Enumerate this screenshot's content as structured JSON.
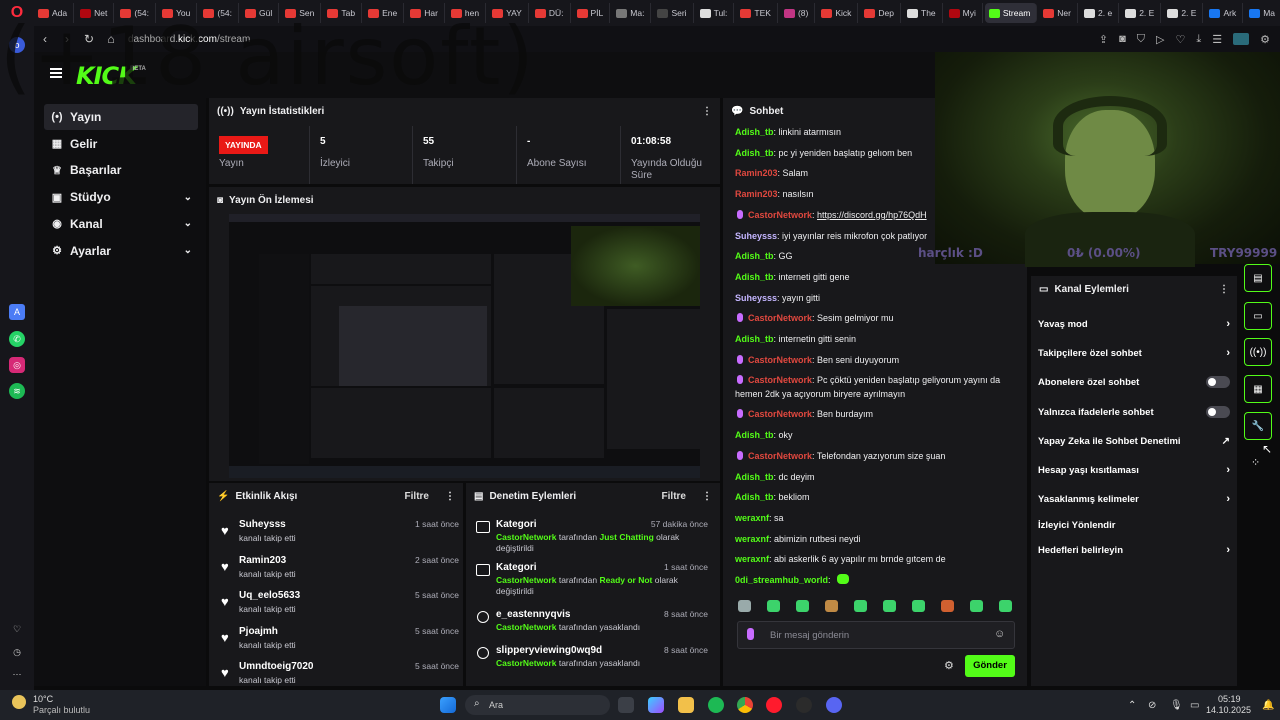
{
  "browser": {
    "tabs": [
      {
        "label": "Ada",
        "color": "#e53935"
      },
      {
        "label": "Net",
        "color": "#b00710"
      },
      {
        "label": "(54:",
        "color": "#e53935"
      },
      {
        "label": "You",
        "color": "#e53935"
      },
      {
        "label": "(54:",
        "color": "#e53935"
      },
      {
        "label": "Gül",
        "color": "#e53935"
      },
      {
        "label": "Sen",
        "color": "#e53935"
      },
      {
        "label": "Tab",
        "color": "#e53935"
      },
      {
        "label": "Ene",
        "color": "#e53935"
      },
      {
        "label": "Har",
        "color": "#e53935"
      },
      {
        "label": "hen",
        "color": "#e53935"
      },
      {
        "label": "YAY",
        "color": "#e53935"
      },
      {
        "label": "DÜ:",
        "color": "#e53935"
      },
      {
        "label": "PİL",
        "color": "#e53935"
      },
      {
        "label": "Ma:",
        "color": "#777"
      },
      {
        "label": "Seri",
        "color": "#444"
      },
      {
        "label": "Tul:",
        "color": "#ddd"
      },
      {
        "label": "TEK",
        "color": "#e53935"
      },
      {
        "label": "(8) ",
        "color": "#c13584"
      },
      {
        "label": "Kick",
        "color": "#e53935"
      },
      {
        "label": "Dep",
        "color": "#e53935"
      },
      {
        "label": "The",
        "color": "#ddd"
      },
      {
        "label": "Myi",
        "color": "#b00710"
      },
      {
        "label": "Stream",
        "color": "#53fc18",
        "active": true
      },
      {
        "label": "Ner",
        "color": "#e53935"
      },
      {
        "label": "2. e",
        "color": "#ddd"
      },
      {
        "label": "2. E",
        "color": "#ddd"
      },
      {
        "label": "2. E",
        "color": "#ddd"
      },
      {
        "label": "Ark",
        "color": "#1877f2"
      },
      {
        "label": "Ma",
        "color": "#1877f2"
      }
    ],
    "new_tab": "+",
    "url_prefix": "dashboard.",
    "url_domain": "kick.com",
    "url_path": "/stream"
  },
  "watermark": "(+18 airsoft)",
  "kick": {
    "logo": "KICK",
    "beta": "BETA",
    "nav": [
      {
        "label": "Yayın",
        "icon": "(•)",
        "selected": true
      },
      {
        "label": "Gelir",
        "icon": "▦"
      },
      {
        "label": "Başarılar",
        "icon": "♕"
      },
      {
        "label": "Stüdyo",
        "icon": "▣",
        "chevron": "⌄"
      },
      {
        "label": "Kanal",
        "icon": "◉",
        "chevron": "⌄"
      },
      {
        "label": "Ayarlar",
        "icon": "⚙",
        "chevron": "⌄"
      }
    ],
    "stats_title": "Yayın İstatistikleri",
    "stats": {
      "live_badge": "YAYINDA",
      "live_label": "Yayın",
      "viewers": "5",
      "viewers_label": "İzleyici",
      "followers": "55",
      "followers_label": "Takipçi",
      "subs": "-",
      "subs_label": "Abone Sayısı",
      "uptime": "01:08:58",
      "uptime_label": "Yayında Olduğu Süre"
    },
    "preview_title": "Yayın Ön İzlemesi",
    "activity": {
      "title": "Etkinlik Akışı",
      "filter": "Filtre",
      "items": [
        {
          "name": "Suheysss",
          "sub": "kanalı takip etti",
          "time": "1 saat önce"
        },
        {
          "name": "Ramin203",
          "sub": "kanalı takip etti",
          "time": "2 saat önce"
        },
        {
          "name": "Uq_eelo5633",
          "sub": "kanalı takip etti",
          "time": "5 saat önce"
        },
        {
          "name": "Pjoajmh",
          "sub": "kanalı takip etti",
          "time": "5 saat önce"
        },
        {
          "name": "Umndtoeig7020",
          "sub": "kanalı takip etti",
          "time": "5 saat önce"
        }
      ]
    },
    "moderation": {
      "title": "Denetim Eylemleri",
      "filter": "Filtre",
      "items": [
        {
          "title": "Kategori",
          "actor": "CastorNetwork",
          "mid": " tarafından ",
          "target": "Just Chatting",
          "end": " olarak değiştirildi",
          "time": "57 dakika önce",
          "kind": "category"
        },
        {
          "title": "Kategori",
          "actor": "CastorNetwork",
          "mid": " tarafından ",
          "target": "Ready or Not",
          "end": " olarak değiştirildi",
          "time": "1 saat önce",
          "kind": "category"
        },
        {
          "title": "e_eastennyqvis",
          "actor": "CastorNetwork",
          "mid": " tarafından yasaklandı",
          "target": "",
          "end": "",
          "time": "8 saat önce",
          "kind": "ban"
        },
        {
          "title": "slipperyviewing0wq9d",
          "actor": "CastorNetwork",
          "mid": " tarafından yasaklandı",
          "target": "",
          "end": "",
          "time": "8 saat önce",
          "kind": "ban"
        }
      ]
    },
    "chat": {
      "title": "Sohbet",
      "messages": [
        {
          "user": "Adish_tb",
          "color": "#53fc18",
          "text": ": linkini atarmısın"
        },
        {
          "user": "Adish_tb",
          "color": "#53fc18",
          "text": ": pc yi yeniden başlatıp gelıom ben"
        },
        {
          "user": "Ramin203",
          "color": "#e0483f",
          "text": ": Salam"
        },
        {
          "user": "Ramin203",
          "color": "#e0483f",
          "text": ": nasılsın"
        },
        {
          "user": "CastorNetwork",
          "color": "#e0483f",
          "text": ": ",
          "link": "https://discord.gg/hp76QdH",
          "mic": true
        },
        {
          "user": "Suheysss",
          "color": "#c4b5ff",
          "text": ": iyi yayınlar reis mikrofon çok patlıyor"
        },
        {
          "user": "Adish_tb",
          "color": "#53fc18",
          "text": ": GG"
        },
        {
          "user": "Adish_tb",
          "color": "#53fc18",
          "text": ": interneti gitti gene"
        },
        {
          "user": "Suheysss",
          "color": "#c4b5ff",
          "text": ": yayın gitti"
        },
        {
          "user": "CastorNetwork",
          "color": "#e0483f",
          "text": ": Sesim gelmiyor mu",
          "mic": true
        },
        {
          "user": "Adish_tb",
          "color": "#53fc18",
          "text": ": internetin gitti senin"
        },
        {
          "user": "CastorNetwork",
          "color": "#e0483f",
          "text": ": Ben seni duyuyorum",
          "mic": true
        },
        {
          "user": "CastorNetwork",
          "color": "#e0483f",
          "text": ": Pc çöktü yeniden başlatıp geliyorum yayını da",
          "text2": "hemen 2dk ya açıyorum biryere ayrılmayın",
          "mic": true
        },
        {
          "user": "CastorNetwork",
          "color": "#e0483f",
          "text": ": Ben burdayım",
          "mic": true
        },
        {
          "user": "Adish_tb",
          "color": "#53fc18",
          "text": ": oky"
        },
        {
          "user": "CastorNetwork",
          "color": "#e0483f",
          "text": ": Telefondan yazıyorum size şuan",
          "mic": true
        },
        {
          "user": "Adish_tb",
          "color": "#53fc18",
          "text": ": dc deyim"
        },
        {
          "user": "Adish_tb",
          "color": "#53fc18",
          "text": ": bekliom"
        },
        {
          "user": "weraxnf",
          "color": "#53fc18",
          "text": ": sa"
        },
        {
          "user": "weraxnf",
          "color": "#53fc18",
          "text": ": abimizin rutbesi neydi"
        },
        {
          "user": "weraxnf",
          "color": "#53fc18",
          "text": ": abi askerlik 6 ay yapılır mı brnde gıtcem de"
        },
        {
          "user": "0di_streamhub_world",
          "color": "#53fc18",
          "text": ":"
        }
      ],
      "placeholder": "Bir mesaj gönderin",
      "send": "Gönder"
    },
    "channel_actions": {
      "title": "Kanal Eylemleri",
      "items": [
        {
          "label": "Yavaş mod",
          "type": "arrow"
        },
        {
          "label": "Takipçilere özel sohbet",
          "type": "arrow"
        },
        {
          "label": "Abonelere özel sohbet",
          "type": "toggle"
        },
        {
          "label": "Yalnızca ifadelerle sohbet",
          "type": "toggle"
        },
        {
          "label": "Yapay Zeka ile Sohbet Denetimi",
          "type": "external"
        },
        {
          "label": "Hesap yaşı kısıtlaması",
          "type": "arrow"
        },
        {
          "label": "Yasaklanmış kelimeler",
          "type": "arrow"
        },
        {
          "label": "İzleyici Yönlendir",
          "type": "none"
        },
        {
          "label": "Hedefleri belirleyin",
          "type": "arrow"
        }
      ]
    },
    "overlay": {
      "left": "harçlık :D",
      "mid": "0₺ (0.00%)",
      "right": "TRY99999"
    }
  },
  "taskbar": {
    "weather_temp": "10°C",
    "weather_desc": "Parçalı bulutlu",
    "search": "Ara",
    "time": "05:19",
    "date": "14.10.2025"
  }
}
